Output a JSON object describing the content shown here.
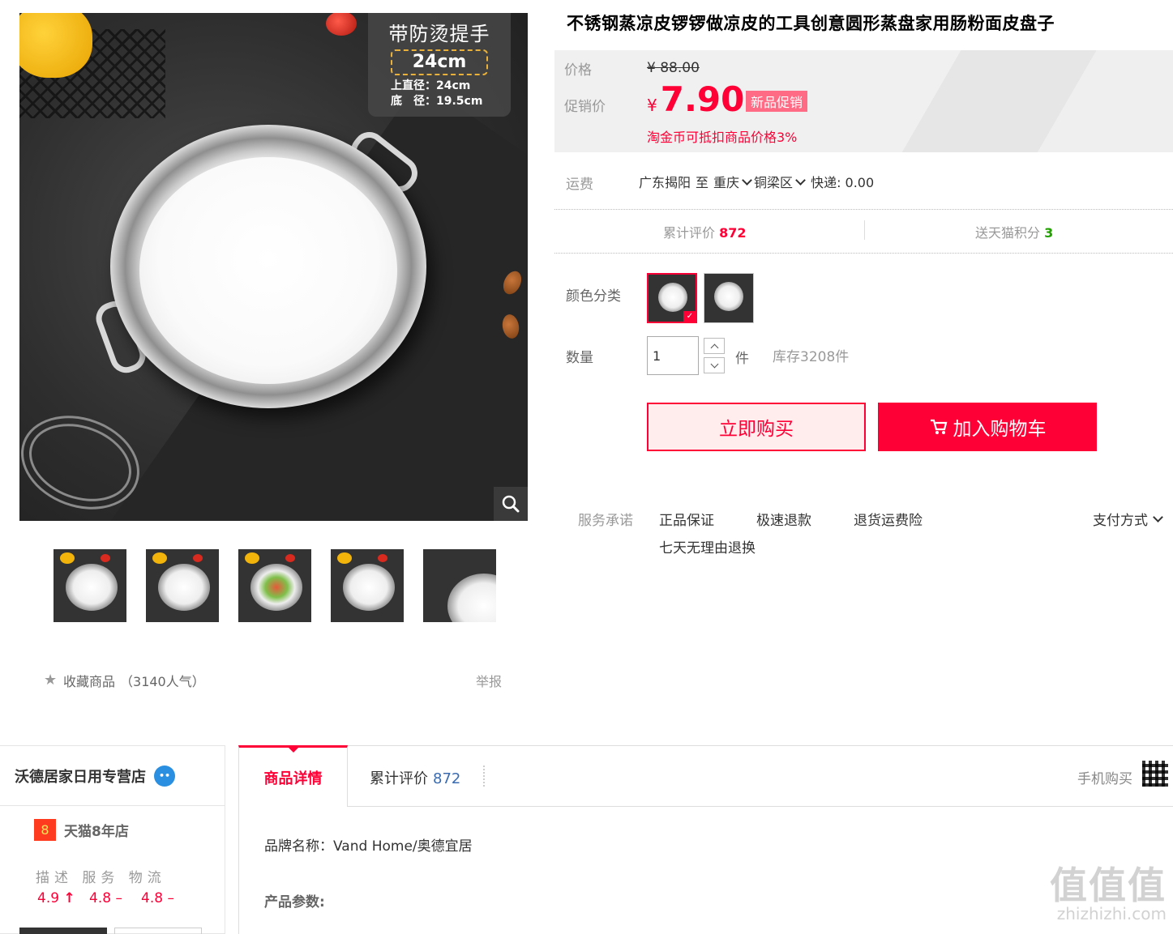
{
  "main_image": {
    "badge_title": "带防烫提手",
    "badge_size": "24cm",
    "badge_spec_top": "上直径：24cm",
    "badge_spec_bottom": "底　径：19.5cm"
  },
  "favorite": {
    "label": "收藏商品",
    "popularity": "（3140人气）",
    "report": "举报"
  },
  "product": {
    "title": "不锈钢蒸凉皮锣锣做凉皮的工具创意圆形蒸盘家用肠粉面皮盘子",
    "price_label": "价格",
    "original_price": "¥ 88.00",
    "promo_label": "促销价",
    "currency": "¥",
    "promo_price": "7.90",
    "promo_tag": "新品促销",
    "coin_text": "淘金币可抵扣商品价格3%"
  },
  "shipping": {
    "label": "运费",
    "from": "广东揭阳",
    "to_word": "至",
    "city": "重庆",
    "district": "铜梁区",
    "method": "快递: 0.00"
  },
  "stats": {
    "reviews_label": "累计评价",
    "reviews_count": "872",
    "points_label": "送天猫积分",
    "points": "3"
  },
  "sku": {
    "label": "颜色分类"
  },
  "quantity": {
    "label": "数量",
    "value": "1",
    "unit": "件",
    "stock": "库存3208件"
  },
  "actions": {
    "buy_now": "立即购买",
    "add_to_cart": "加入购物车"
  },
  "services": {
    "label": "服务承诺",
    "items": [
      "正品保证",
      "极速退款",
      "退货运费险",
      "七天无理由退换"
    ],
    "payment": "支付方式"
  },
  "shop": {
    "name": "沃德居家日用专营店",
    "tmall_years_num": "8",
    "tmall_years": "天猫8年店",
    "score_heading": "描述 服务 物流",
    "scores": [
      "4.9",
      "4.8",
      "4.8"
    ]
  },
  "tabs": {
    "details": "商品详情",
    "reviews": "累计评价",
    "reviews_count": "872",
    "mobile_buy": "手机购买"
  },
  "details": {
    "brand": "品牌名称：Vand Home/奥德宜居",
    "params": "产品参数:"
  },
  "watermark": {
    "big": "值值值",
    "small": "zhizhizhi.com"
  },
  "colors": {
    "accent": "#ff0036",
    "promo_tag_bg": "#ff6a85",
    "link_blue": "#3a6bb0",
    "points_green": "#22a000"
  }
}
